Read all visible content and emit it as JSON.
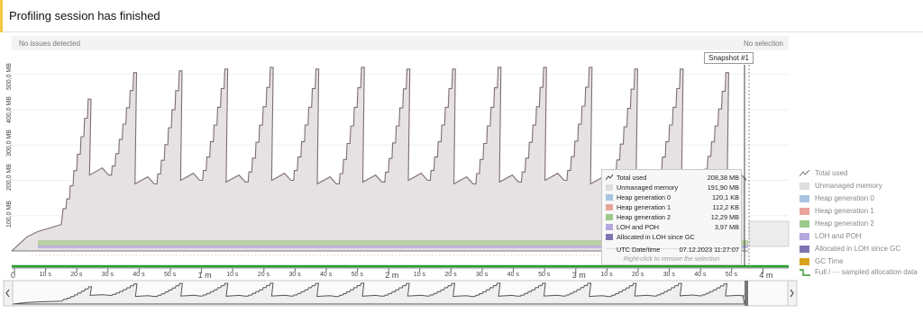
{
  "header": {
    "title": "Profiling session has finished"
  },
  "infobar": {
    "left": "No issues detected",
    "right": "No selection"
  },
  "snapshot": {
    "label": "Snapshot #1"
  },
  "y_axis": {
    "ticks": [
      "500,0 MB",
      "400,0 MB",
      "300,0 MB",
      "200,0 MB",
      "100,0 MB"
    ]
  },
  "x_axis": {
    "ticks": [
      "0",
      "10 s",
      "20 s",
      "30 s",
      "40 s",
      "50 s",
      "1 m",
      "10 s",
      "20 s",
      "30 s",
      "40 s",
      "50 s",
      "2 m",
      "10 s",
      "20 s",
      "30 s",
      "40 s",
      "50 s",
      "3 m",
      "10 s",
      "20 s",
      "30 s",
      "40 s",
      "50 s",
      "4 m"
    ]
  },
  "tooltip": {
    "rows": [
      {
        "label": "Total used",
        "value": "208,38 MB",
        "icon": "line-icon"
      },
      {
        "label": "Unmanaged memory",
        "value": "191,90 MB",
        "color": "#dedede"
      },
      {
        "label": "Heap generation 0",
        "value": "120,1 KB",
        "color": "#a8c4e0"
      },
      {
        "label": "Heap generation 1",
        "value": "112,2 KB",
        "color": "#e8a39a"
      },
      {
        "label": "Heap generation 2",
        "value": "12,29 MB",
        "color": "#9cc98a"
      },
      {
        "label": "LOH and POH",
        "value": "3,97 MB",
        "color": "#b6a7df"
      },
      {
        "label": "Allocated in LOH since GC",
        "value": "",
        "color": "#7e74b0"
      }
    ],
    "date_label": "UTC Date/time",
    "date_value": "07.12.2023 11:27:07",
    "hint": "Right-click to remove the selection"
  },
  "legend": {
    "items": [
      {
        "label": "Total used",
        "icon": "line-icon",
        "color": "#777777"
      },
      {
        "label": "Unmanaged memory",
        "color": "#dedede"
      },
      {
        "label": "Heap generation 0",
        "color": "#a8c4e0"
      },
      {
        "label": "Heap generation 1",
        "color": "#e8a39a"
      },
      {
        "label": "Heap generation 2",
        "color": "#9cc98a"
      },
      {
        "label": "LOH and POH",
        "color": "#b6a7df"
      },
      {
        "label": "Allocated in LOH since GC",
        "color": "#7e74b0"
      },
      {
        "label": "GC Time",
        "color": "#d9a21b"
      },
      {
        "label": "Full / ⋯ sampled allocation data",
        "icon": "step-line-icon",
        "color": "#2e9a2e"
      }
    ]
  },
  "chart_data": {
    "type": "area",
    "ylabel": "",
    "ylim": [
      0,
      540
    ],
    "sawtooth_peaks_mb": [
      430,
      505,
      510,
      515,
      520,
      515,
      520,
      515,
      515,
      520,
      520,
      520,
      515,
      515,
      505
    ],
    "sawtooth_troughs_mb": [
      120,
      215,
      190,
      200,
      195,
      200,
      190,
      195,
      200,
      190,
      195,
      200,
      190,
      200,
      205
    ],
    "selection_total_used_mb": 208.38
  }
}
